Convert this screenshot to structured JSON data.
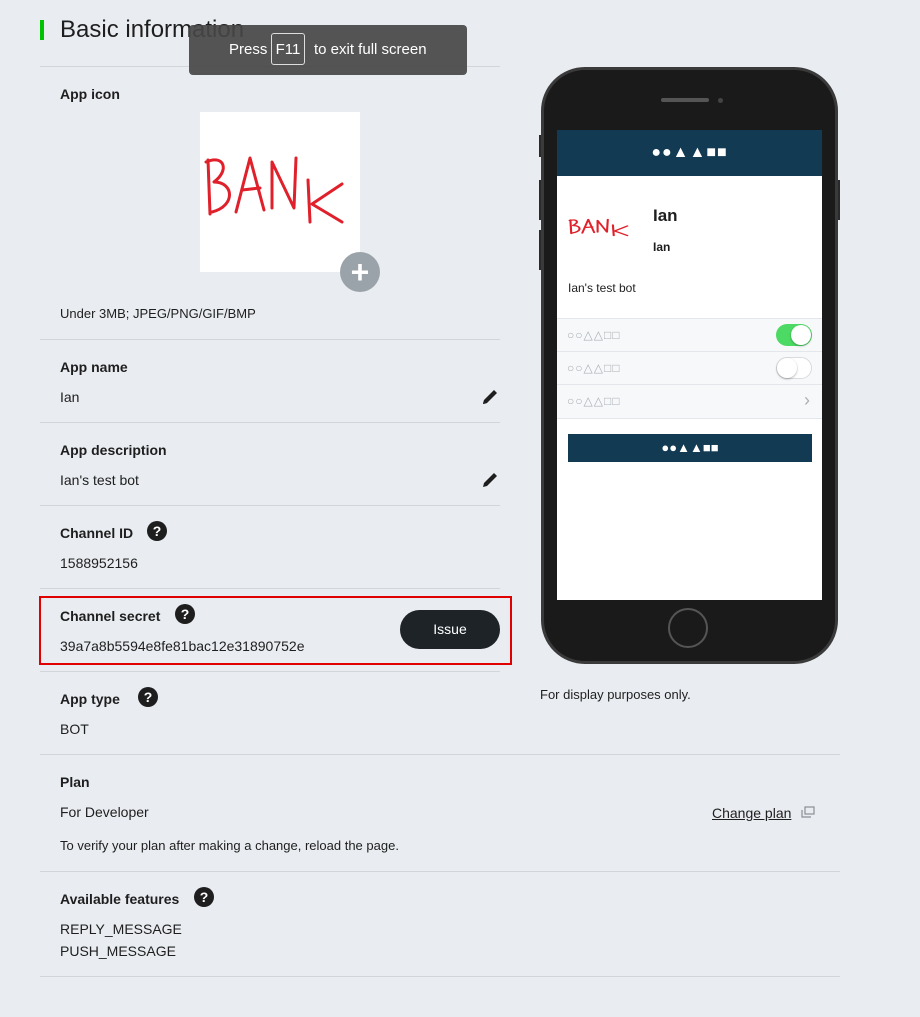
{
  "section_title": "Basic information",
  "toast": {
    "press": "Press",
    "key": "F11",
    "suffix": "to exit full screen"
  },
  "app_icon": {
    "label": "App icon",
    "icon_text": "BANK",
    "hint": "Under 3MB; JPEG/PNG/GIF/BMP",
    "add_symbol": "+"
  },
  "app_name": {
    "label": "App name",
    "value": "Ian"
  },
  "app_description": {
    "label": "App description",
    "value": "Ian's test bot"
  },
  "channel_id": {
    "label": "Channel ID",
    "value": "1588952156",
    "help": "?"
  },
  "channel_secret": {
    "label": "Channel secret",
    "value": "39a7a8b5594e8fe81bac12e31890752e",
    "help": "?",
    "button": "Issue"
  },
  "app_type": {
    "label": "App type",
    "value": "BOT",
    "help": "?"
  },
  "plan": {
    "label": "Plan",
    "value": "For Developer",
    "change_link": "Change plan",
    "note": "To verify your plan after making a change, reload the page."
  },
  "features": {
    "label": "Available features",
    "help": "?",
    "items": [
      "REPLY_MESSAGE",
      "PUSH_MESSAGE"
    ]
  },
  "preview": {
    "header_shapes": "●●▲▲■■",
    "name": "Ian",
    "sub_name": "Ian",
    "description": "Ian's test bot",
    "row_shapes": "○○△△□□",
    "rows": [
      {
        "shapes": "○○△△□□",
        "control": "toggle",
        "on": true
      },
      {
        "shapes": "○○△△□□",
        "control": "toggle",
        "on": false
      },
      {
        "shapes": "○○△△□□",
        "control": "chevron"
      }
    ],
    "chevron": "›",
    "button_shapes": "●●▲▲■■",
    "disclaimer": "For display purposes only."
  },
  "colors": {
    "accent": "#00c300",
    "toggle_on": "#4cd964",
    "toggle_off": "#ffffff",
    "dark_navy": "#123a52",
    "highlight_red": "#e00000"
  }
}
